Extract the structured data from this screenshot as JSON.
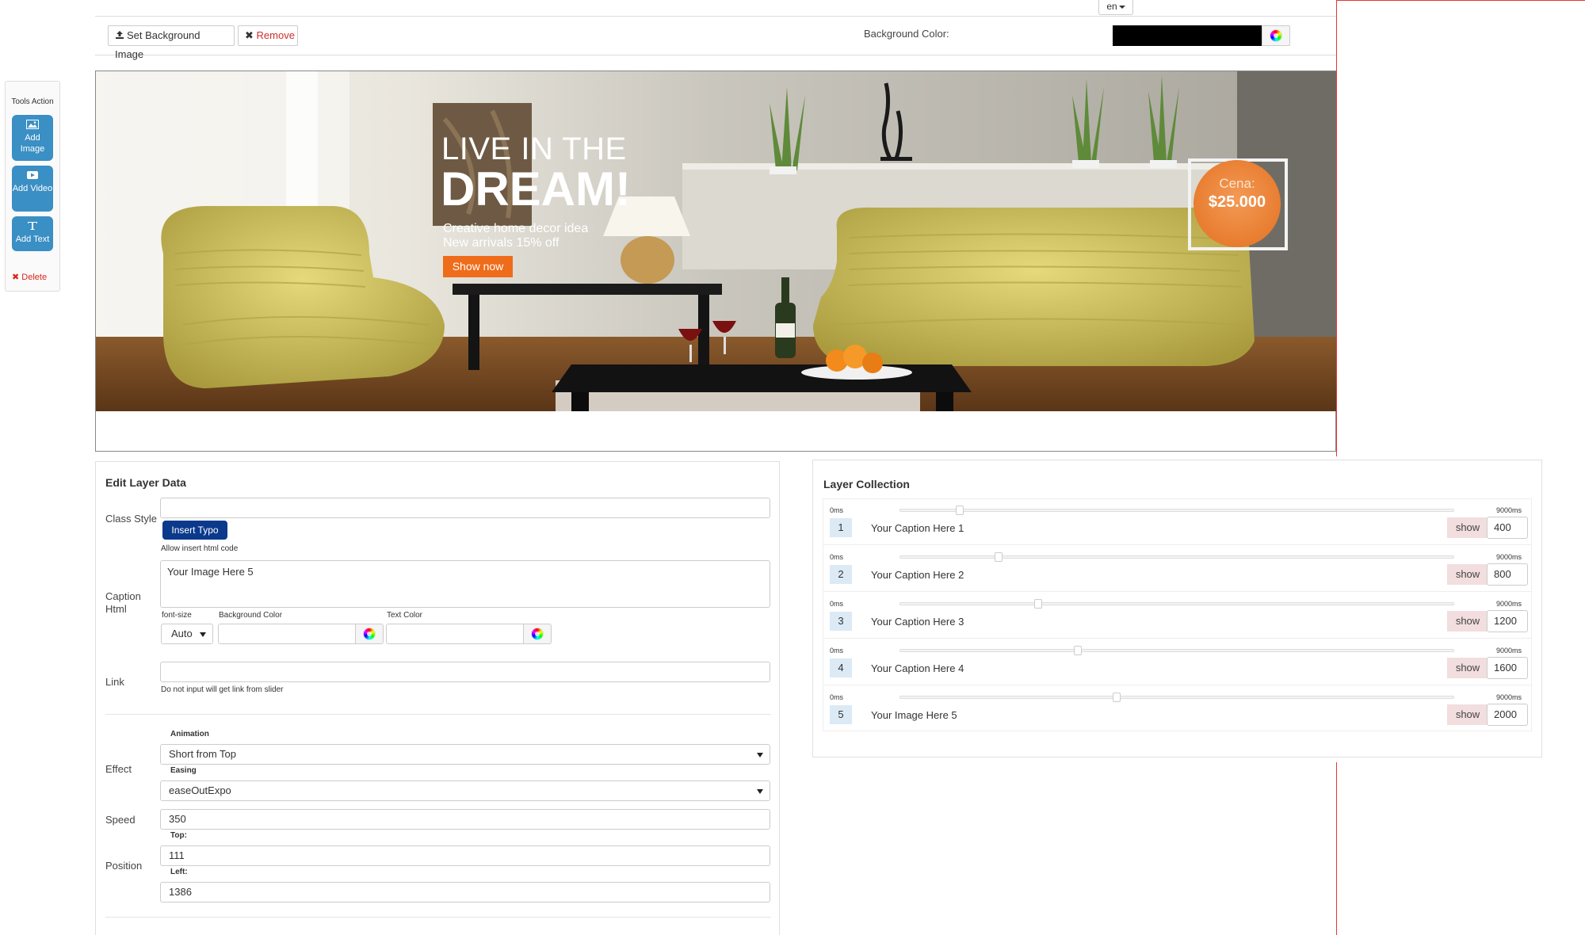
{
  "lang": {
    "selected": "en"
  },
  "toolbar": {
    "set_bg_label": "Set Background Image",
    "remove_label": "Remove",
    "bg_color_label": "Background Color:",
    "bg_color_value": "#000000"
  },
  "tools": {
    "title": "Tools Action",
    "add_image": "Add Image",
    "add_video": "Add Video",
    "add_text": "Add Text",
    "delete": "Delete"
  },
  "banner": {
    "headline1": "LIVE IN THE",
    "headline2": "DREAM!",
    "sub1": "Creative home decor idea",
    "sub2": "New arrivals 15% off",
    "cta": "Show now",
    "price_label": "Cena:",
    "price_value": "$25.000"
  },
  "edit": {
    "title": "Edit Layer Data",
    "class_style_label": "Class Style",
    "class_style_value": "",
    "insert_typo": "Insert Typo",
    "allow_html": "Allow insert html code",
    "caption_label_1": "Caption",
    "caption_label_2": "Html",
    "caption_value": "Your Image Here 5",
    "font_size_label": "font-size",
    "font_size_value": "Auto",
    "bg_color_label": "Background Color",
    "text_color_label": "Text Color",
    "link_label": "Link",
    "link_value": "",
    "link_hint": "Do not input will get link from slider",
    "animation_label": "Animation",
    "effect_label": "Effect",
    "effect_value": "Short from Top",
    "easing_label": "Easing",
    "easing_value": "easeOutExpo",
    "speed_label": "Speed",
    "speed_value": "350",
    "position_label": "Position",
    "top_label": "Top:",
    "top_value": "111",
    "left_label": "Left:",
    "left_value": "1386"
  },
  "layers": {
    "title": "Layer Collection",
    "start": "0ms",
    "end": "9000ms",
    "show_label": "show",
    "items": [
      {
        "num": "1",
        "caption": "Your Caption Here 1",
        "value": "400",
        "time": 400
      },
      {
        "num": "2",
        "caption": "Your Caption Here 2",
        "value": "800",
        "time": 800
      },
      {
        "num": "3",
        "caption": "Your Caption Here 3",
        "value": "1200",
        "time": 1200
      },
      {
        "num": "4",
        "caption": "Your Caption Here 4",
        "value": "1600",
        "time": 1600
      },
      {
        "num": "5",
        "caption": "Your Image Here 5",
        "value": "2000",
        "time": 2000
      }
    ]
  },
  "colors": {
    "accent_blue": "#3a8fc4",
    "typo_blue": "#0b3a8c",
    "cta_orange": "#ef6c1a",
    "price_orange": "#f0883c",
    "delete_red": "#d9261c"
  }
}
